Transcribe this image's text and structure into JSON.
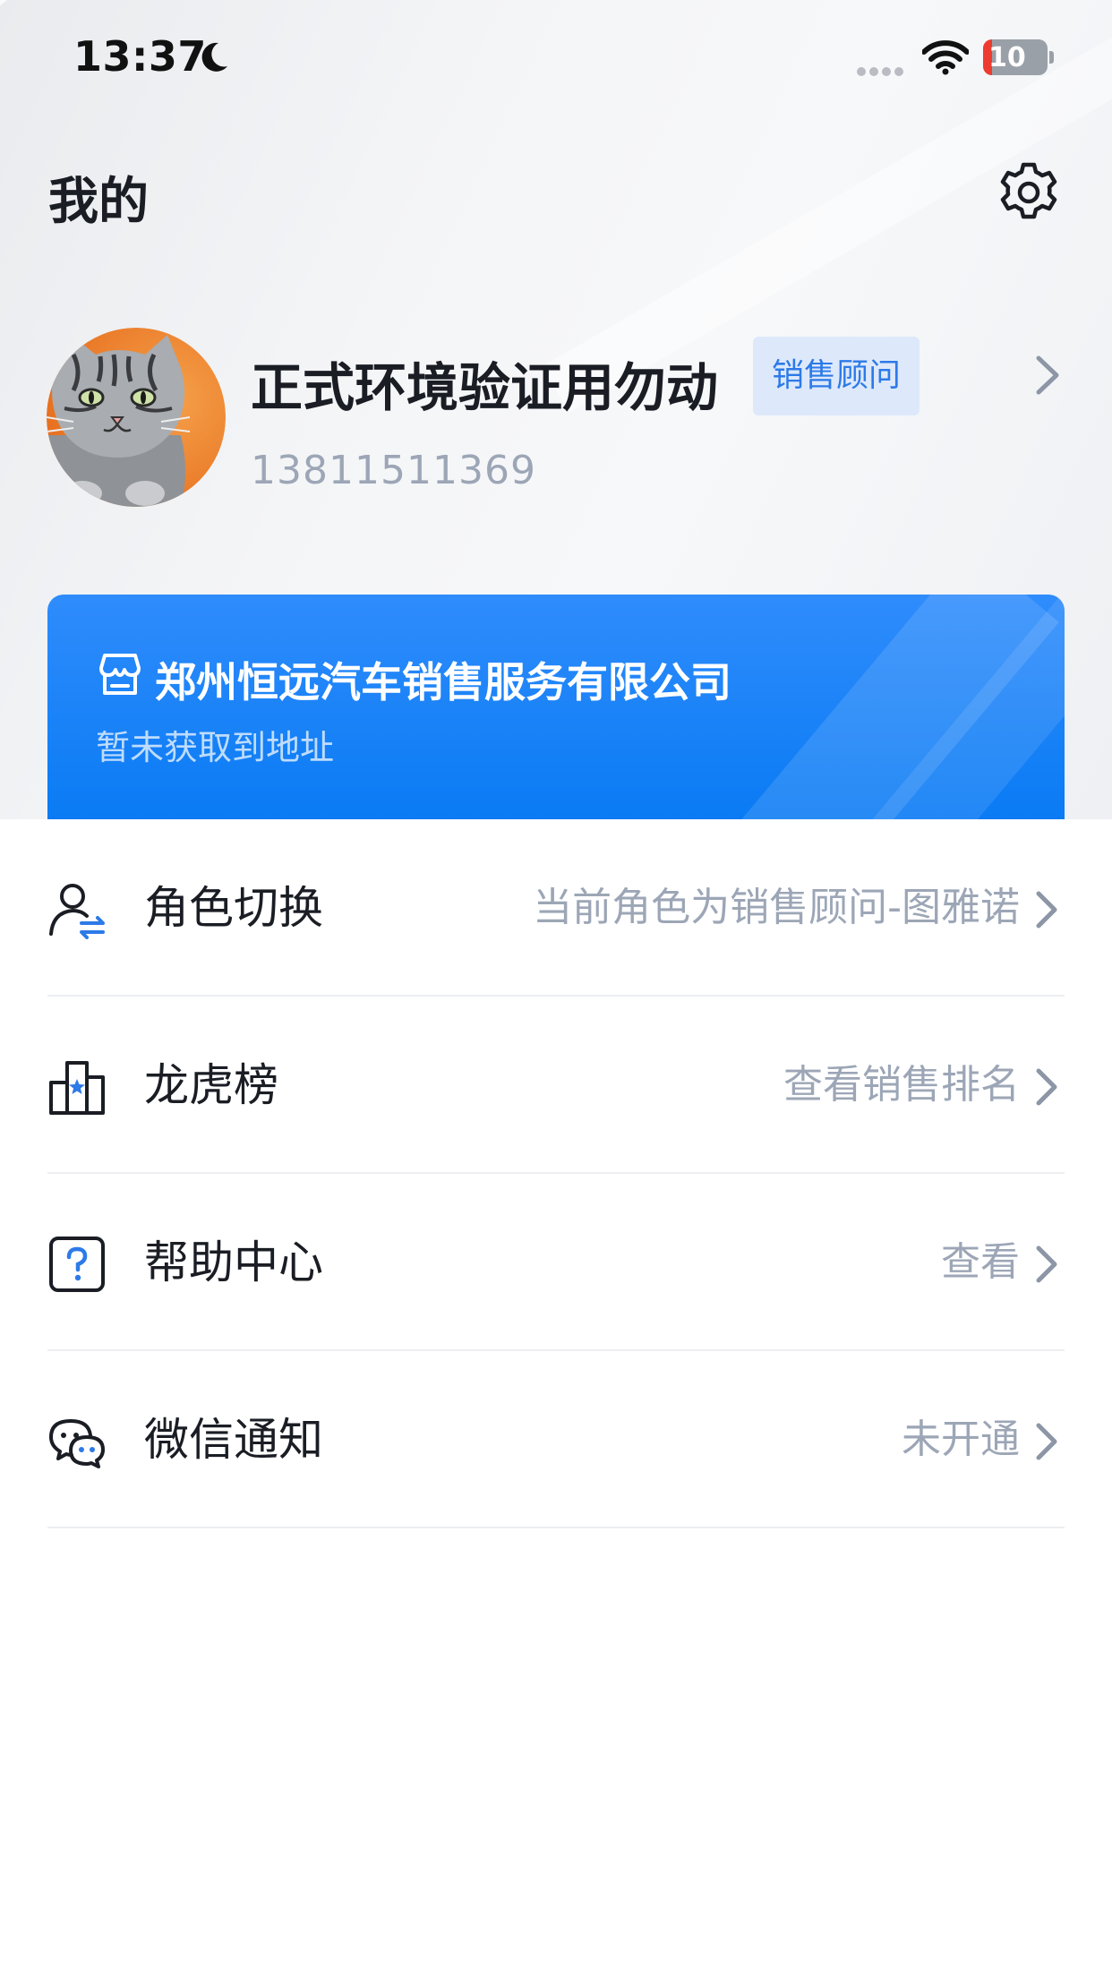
{
  "status_bar": {
    "time": "13:37",
    "battery": "10"
  },
  "header": {
    "title": "我的"
  },
  "profile": {
    "name": "正式环境验证用勿动",
    "role_badge": "销售顾问",
    "phone": "13811511369"
  },
  "company": {
    "name": "郑州恒远汽车销售服务有限公司",
    "address": "暂未获取到地址"
  },
  "menu": [
    {
      "label": "角色切换",
      "value": "当前角色为销售顾问-图雅诺",
      "icon": "role-switch-icon"
    },
    {
      "label": "龙虎榜",
      "value": "查看销售排名",
      "icon": "leaderboard-icon"
    },
    {
      "label": "帮助中心",
      "value": "查看",
      "icon": "help-icon"
    },
    {
      "label": "微信通知",
      "value": "未开通",
      "icon": "wechat-icon"
    }
  ],
  "colors": {
    "accent": "#2d7ae8",
    "card": "#0a7bf4",
    "muted_text": "#9ca6b6"
  }
}
